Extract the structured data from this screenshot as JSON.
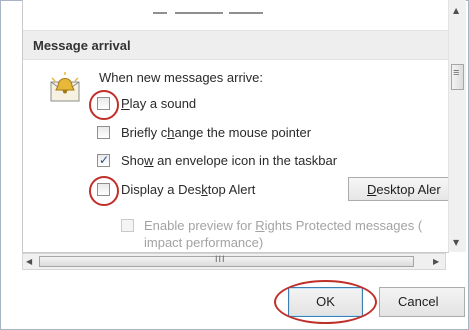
{
  "section": {
    "title": "Message arrival"
  },
  "intro": "When new messages arrive:",
  "options": [
    {
      "pre": "",
      "key": "P",
      "post": "lay a sound",
      "checked": false
    },
    {
      "pre": "Briefly c",
      "key": "h",
      "post": "ange the mouse pointer",
      "checked": false
    },
    {
      "pre": "Sho",
      "key": "w",
      "post": " an envelope icon in the taskbar",
      "checked": true
    },
    {
      "pre": "Display a Des",
      "key": "k",
      "post": "top Alert",
      "checked": false
    }
  ],
  "desktop_alert_button": {
    "pre": "",
    "key": "D",
    "post": "esktop Aler"
  },
  "preview_option": {
    "pre": "Enable preview for ",
    "key": "R",
    "post": "ights Protected messages (",
    "line2": "impact performance)",
    "enabled": false
  },
  "hscroll_grip": "III",
  "buttons": {
    "ok": "OK",
    "cancel": "Cancel"
  },
  "icons": {
    "envelope": "new-mail-bell-icon",
    "scroll_up": "▲",
    "scroll_down": "▼",
    "scroll_left": "◀",
    "scroll_right": "▶",
    "vthumb_grip": "≡"
  },
  "colors": {
    "highlight_ring": "#c0302a",
    "section_bar": "#eeeeee"
  }
}
